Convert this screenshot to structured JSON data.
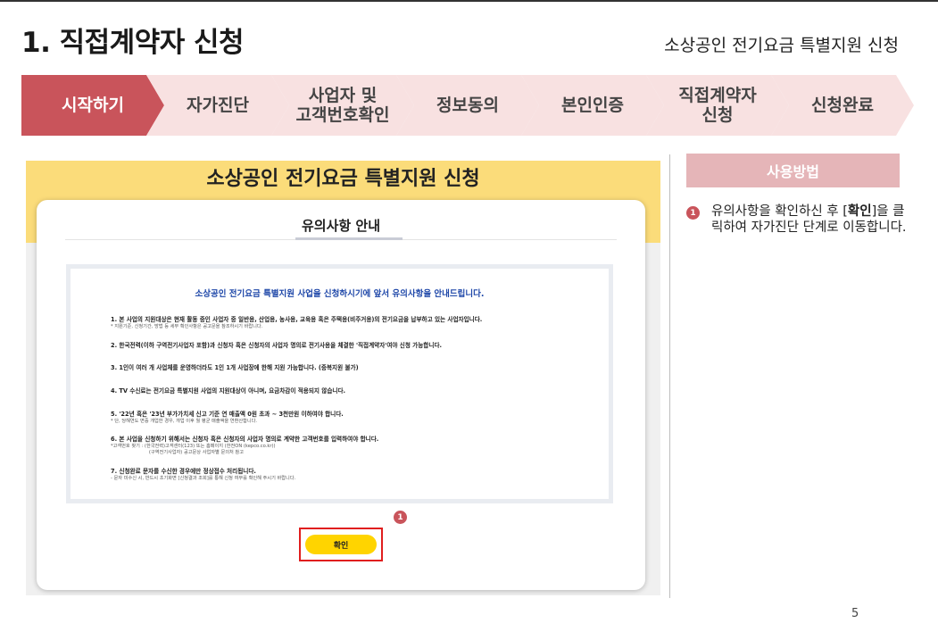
{
  "slide": {
    "title": "1. 직접계약자 신청",
    "subtitle": "소상공인 전기요금 특별지원 신청",
    "page_number": "5"
  },
  "steps": [
    {
      "label": "시작하기",
      "active": true
    },
    {
      "label": "자가진단",
      "active": false
    },
    {
      "label": "사업자 및\n고객번호확인",
      "active": false
    },
    {
      "label": "정보동의",
      "active": false
    },
    {
      "label": "본인인증",
      "active": false
    },
    {
      "label": "직접계약자\n신청",
      "active": false
    },
    {
      "label": "신청완료",
      "active": false
    }
  ],
  "screenshot": {
    "page_title": "소상공인 전기요금 특별지원 신청",
    "modal_title": "유의사항 안내",
    "notice_heading": "소상공인 전기요금 특별지원 사업을 신청하시기에 앞서 유의사항을 안내드립니다.",
    "items": [
      {
        "main": "1. 본 사업의 지원대상은 현재 활동 중인 사업자 중 일반용, 산업용, 농사용, 교육용 혹은 주택용(비주거용)의 전기요금을 납부하고 있는 사업자입니다.",
        "sub": "* 지원기준, 신청기간, 방법 등 세부 확인사항은 공고문을 참조하시기 바랍니다."
      },
      {
        "main": "2. 한국전력(이하 구역전기사업자 포함)과 신청자 혹은 신청자의 사업자 명의로 전기사용을 체결한 '직접계약자'여야 신청 가능합니다.",
        "sub": ""
      },
      {
        "main": "3. 1인이 여러 개 사업체를 운영하더라도 1인 1개 사업장에 한해 지원 가능합니다. (중복지원 불가)",
        "sub": ""
      },
      {
        "main": "4. TV 수신료는 전기요금 특별지원 사업의 지원대상이 아니며, 요금차감이 적용되지 않습니다.",
        "sub": ""
      },
      {
        "main": "5. '22년 혹은 '23년 부가가치세 신고 기준 연 매출액 0원 초과 ~ 3천만원 이하여야 합니다.",
        "sub": "* 단, 당해연도 면중 개업한 경우, 개업 이후 월 평균 매출액을 연환산합니다."
      },
      {
        "main": "6. 본 사업을 신청하기 위해서는 신청자 혹은 신청자의 사업자 명의로 계약한 고객번호를 입력하여야 합니다.",
        "sub": "*고객번호 찾기 : (한국전력)고객센터(123) 또는 홈페이지 (한전ON (kepco.co.kr))\n                          (구역전기사업자) 공고문상 사업자별 문의처 참고"
      },
      {
        "main": "7. 신청완료 문자를 수신한 경우에만 정상접수 처리됩니다.",
        "sub": "- 문자 미수신 시, 반드시 초기화면 [신청결과 조회]를 통해 신청 여부를 확인해 주시기 바랍니다."
      }
    ],
    "badge": "1",
    "confirm_label": "확인"
  },
  "howto": {
    "header": "사용방법",
    "badge": "1",
    "text_before": "유의사항을 확인하신 후 [",
    "text_bold": "확인",
    "text_after": "]을 클릭하여 자가진단 단계로 이동합니다."
  },
  "colors": {
    "accent_red": "#c9545b",
    "step_pink": "#f8e1e1",
    "header_yellow": "#fbdc7a",
    "button_yellow": "#ffd400",
    "notice_blue": "#1d46a8"
  }
}
